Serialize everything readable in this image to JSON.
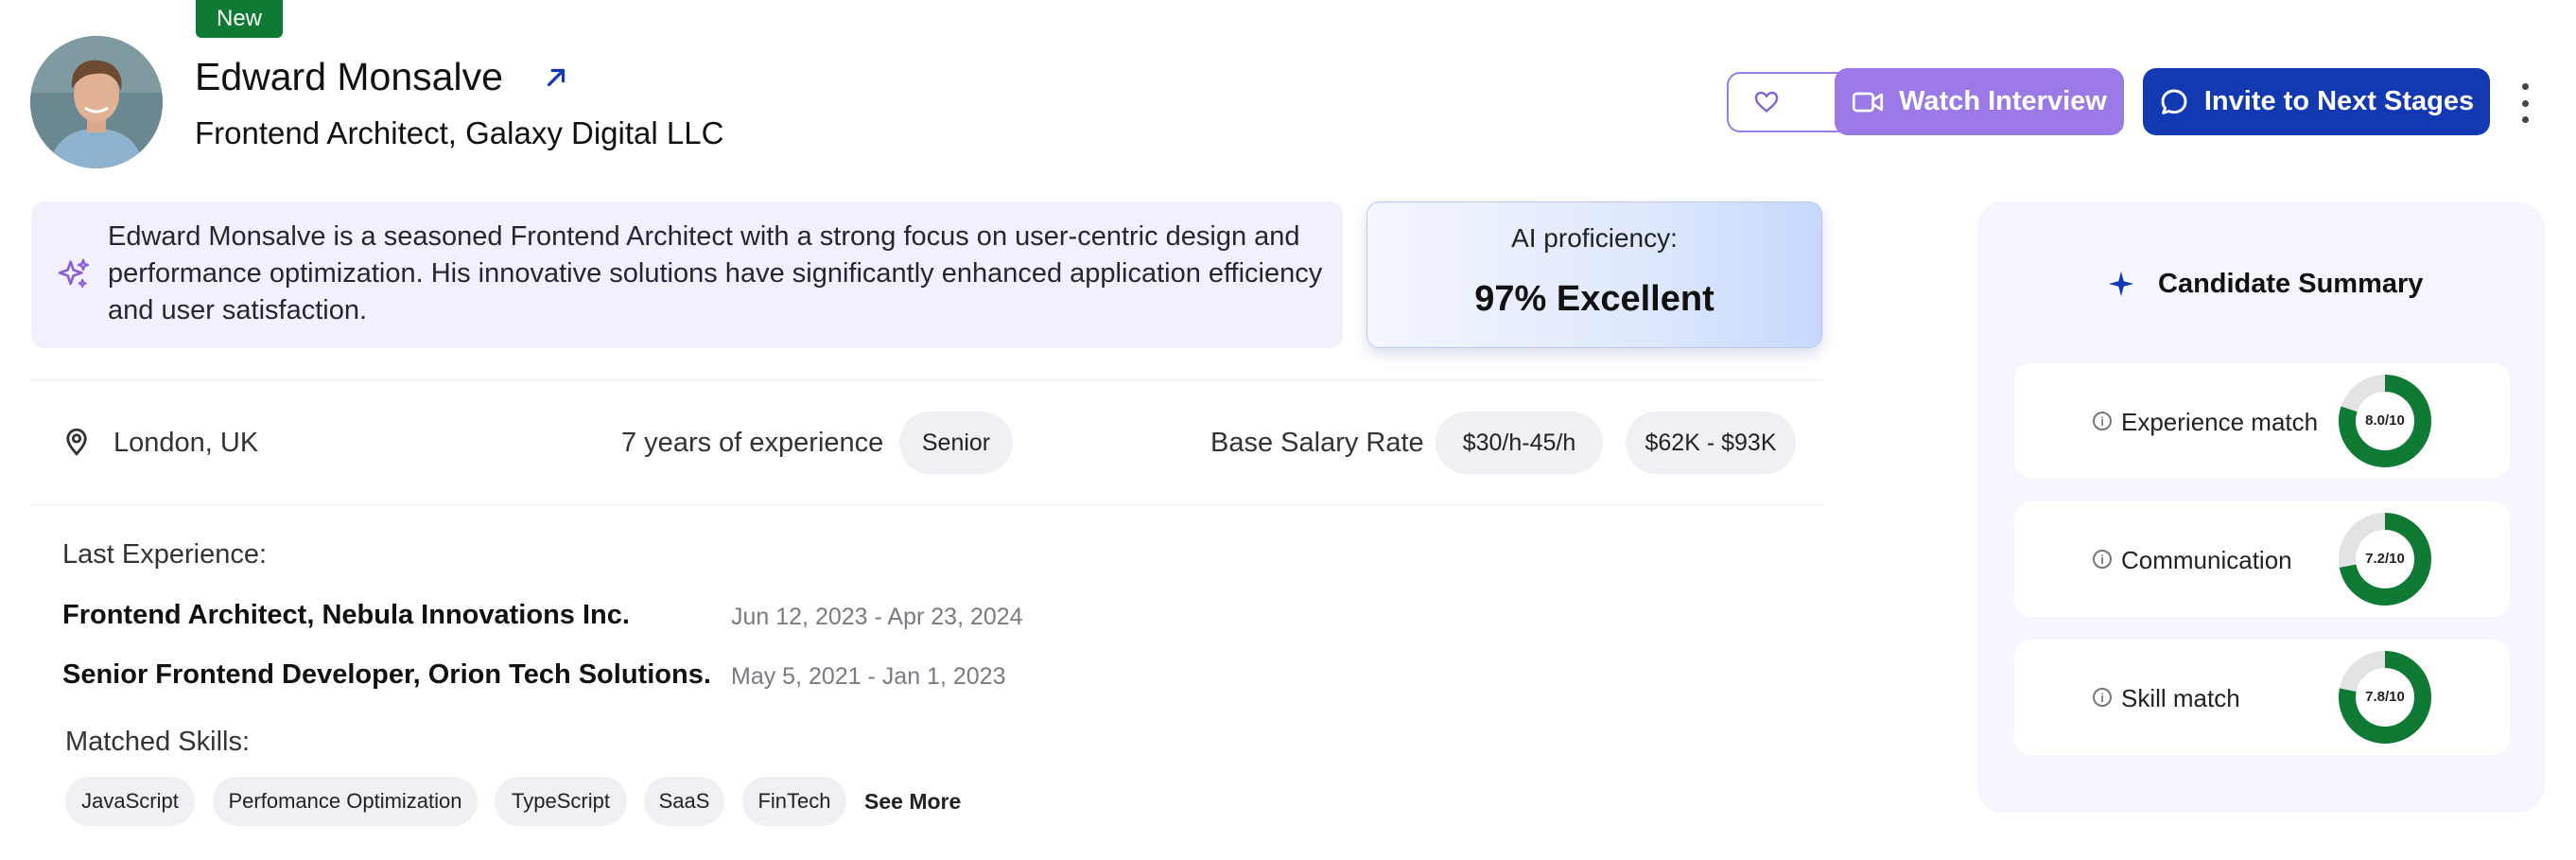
{
  "candidate": {
    "badge": "New",
    "name": "Edward Monsalve",
    "role": "Frontend Architect, Galaxy Digital LLC"
  },
  "actions": {
    "watch_label": "Watch Interview",
    "invite_label": "Invite to Next Stages"
  },
  "bio": "Edward Monsalve is a seasoned Frontend Architect with a strong focus on user-centric design and performance optimization. His innovative solutions have significantly enhanced application efficiency and user satisfaction.",
  "ai": {
    "label": "AI proficiency:",
    "value": "97% Excellent"
  },
  "info": {
    "location": "London, UK",
    "experience": "7 years of experience",
    "level": "Senior",
    "salary_label": "Base Salary Rate",
    "hourly": "$30/h-45/h",
    "annual": "$62K - $93K"
  },
  "last_experience": {
    "title": "Last Experience:",
    "items": [
      {
        "role": "Frontend Architect, Nebula Innovations Inc.",
        "dates": "Jun 12, 2023 - Apr 23, 2024"
      },
      {
        "role": "Senior Frontend Developer, Orion Tech Solutions.",
        "dates": "May 5, 2021 - Jan 1, 2023"
      }
    ]
  },
  "skills": {
    "title": "Matched Skills:",
    "items": [
      "JavaScript",
      "Perfomance Optimization",
      "TypeScript",
      "SaaS",
      "FinTech"
    ],
    "see_more": "See More"
  },
  "summary": {
    "title": "Candidate Summary",
    "metrics": [
      {
        "label": "Experience match",
        "score": "8.0/10",
        "value": 8.0
      },
      {
        "label": "Communication",
        "score": "7.2/10",
        "value": 7.2
      },
      {
        "label": "Skill match",
        "score": "7.8/10",
        "value": 7.8
      }
    ]
  },
  "colors": {
    "badge_green": "#0f7a34",
    "watch_purple": "#9b7ae8",
    "invite_blue": "#1238b2",
    "ring_green": "#0f7a34",
    "ring_track": "#e3e3e6"
  },
  "icons": {
    "external_link": "arrow-up-right-icon",
    "favorite": "heart-icon",
    "watch": "video-icon",
    "invite": "chat-bubble-icon",
    "more": "more-vertical-icon",
    "bio": "sparkles-icon",
    "location": "map-pin-icon",
    "summary": "star-icon",
    "metric_info": "info-icon"
  }
}
